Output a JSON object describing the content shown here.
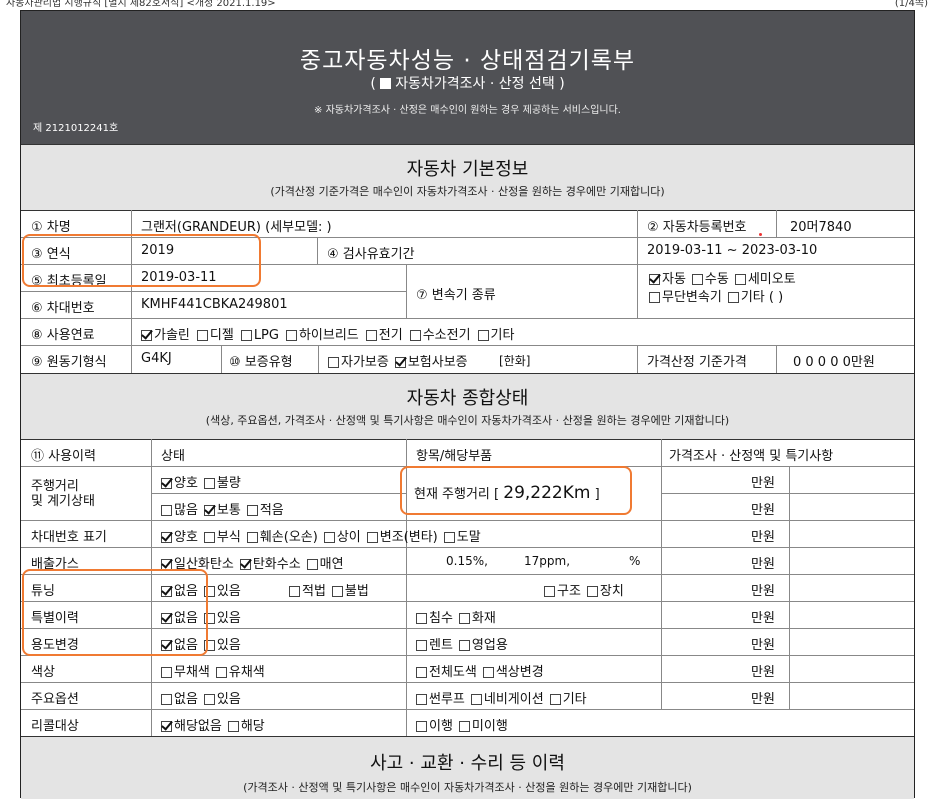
{
  "top": {
    "left": "자동차관리법 시행규칙 [별지 제82호서식] <개정 2021.1.19>",
    "right": "(1/4쪽)"
  },
  "header": {
    "title": "중고자동차성능 · 상태점검기록부",
    "sub_open": "(",
    "sub_text": "자동차가격조사 · 산정 선택",
    "sub_close": ")",
    "note": "※ 자동차가격조사 · 산정은 매수인이 원하는 경우 제공하는 서비스입니다.",
    "doc_no": "제 2121012241호"
  },
  "basic": {
    "title": "자동차 기본정보",
    "subtitle": "(가격산정 기준가격은 매수인이 자동차가격조사 · 산정을 원하는 경우에만 기재합니다)",
    "car_name_label": "① 차명",
    "car_name": "그랜저(GRANDEUR) (세부모델: )",
    "reg_no_label": "② 자동차등록번호",
    "reg_no": "20머7840",
    "year_label": "③ 연식",
    "year": "2019",
    "inspect_label": "④ 검사유효기간",
    "inspect_period": "2019-03-11 ~ 2023-03-10",
    "first_reg_label": "⑤ 최초등록일",
    "first_reg": "2019-03-11",
    "trans_label": "⑦ 변속기 종류",
    "trans_options_1": [
      {
        "label": "자동",
        "checked": true
      },
      {
        "label": "수동",
        "checked": false
      },
      {
        "label": "세미오토",
        "checked": false
      }
    ],
    "trans_options_2": [
      {
        "label": "무단변속기",
        "checked": false
      },
      {
        "label": "기타 (      )",
        "checked": false
      }
    ],
    "vin_label": "⑥ 차대번호",
    "vin": "KMHF441CBKA249801",
    "fuel_label": "⑧ 사용연료",
    "fuel_options": [
      {
        "label": "가솔린",
        "checked": true
      },
      {
        "label": "디젤",
        "checked": false
      },
      {
        "label": "LPG",
        "checked": false
      },
      {
        "label": "하이브리드",
        "checked": false
      },
      {
        "label": "전기",
        "checked": false
      },
      {
        "label": "수소전기",
        "checked": false
      },
      {
        "label": "기타",
        "checked": false
      }
    ],
    "engine_label": "⑨ 원동기형식",
    "engine": "G4KJ",
    "warranty_label": "⑩ 보증유형",
    "warranty_options": [
      {
        "label": "자가보증",
        "checked": false
      },
      {
        "label": "보험사보증",
        "checked": true
      }
    ],
    "warranty_company": "[한화]",
    "price_label": "가격산정 기준가격",
    "price_value": "0 0 0 0 0만원"
  },
  "overall": {
    "title": "자동차 종합상태",
    "subtitle": "(색상, 주요옵션, 가격조사 · 산정액 및 특기사항은 매수인이 자동차가격조사 · 산정을 원하는 경우에만 기재합니다)",
    "col_history": "⑪ 사용이력",
    "col_status": "상태",
    "col_item": "항목/해당부품",
    "col_price": "가격조사 · 산정액 및 특기사항",
    "unit": "만원",
    "mileage_label": "주행거리\n및 계기상태",
    "mileage_opts_1": [
      {
        "label": "양호",
        "checked": true
      },
      {
        "label": "불량",
        "checked": false
      }
    ],
    "mileage_opts_2": [
      {
        "label": "많음",
        "checked": false
      },
      {
        "label": "보통",
        "checked": true
      },
      {
        "label": "적음",
        "checked": false
      }
    ],
    "mileage_text_prefix": "현재 주행거리 [",
    "mileage_value": "29,222Km",
    "mileage_text_suffix": "]",
    "vin_mark_label": "차대번호 표기",
    "vin_mark_opts": [
      {
        "label": "양호",
        "checked": true
      },
      {
        "label": "부식",
        "checked": false
      },
      {
        "label": "훼손(오손)",
        "checked": false
      },
      {
        "label": "상이",
        "checked": false
      },
      {
        "label": "변조(변타)",
        "checked": false
      },
      {
        "label": "도말",
        "checked": false
      }
    ],
    "emission_label": "배출가스",
    "emission_opts": [
      {
        "label": "일산화탄소",
        "checked": true
      },
      {
        "label": "탄화수소",
        "checked": true
      },
      {
        "label": "매연",
        "checked": false
      }
    ],
    "emission_co": "0.15%,",
    "emission_hc": "17ppm,",
    "emission_pct": "%",
    "tuning_label": "튜닝",
    "tuning_opts": [
      {
        "label": "없음",
        "checked": true
      },
      {
        "label": "있음",
        "checked": false
      }
    ],
    "tuning_legal": [
      {
        "label": "적법",
        "checked": false
      },
      {
        "label": "불법",
        "checked": false
      }
    ],
    "tuning_parts": [
      {
        "label": "구조",
        "checked": false
      },
      {
        "label": "장치",
        "checked": false
      }
    ],
    "special_label": "특별이력",
    "special_opts": [
      {
        "label": "없음",
        "checked": true
      },
      {
        "label": "있음",
        "checked": false
      }
    ],
    "special_parts": [
      {
        "label": "침수",
        "checked": false
      },
      {
        "label": "화재",
        "checked": false
      }
    ],
    "usage_label": "용도변경",
    "usage_opts": [
      {
        "label": "없음",
        "checked": true
      },
      {
        "label": "있음",
        "checked": false
      }
    ],
    "usage_parts": [
      {
        "label": "렌트",
        "checked": false
      },
      {
        "label": "영업용",
        "checked": false
      }
    ],
    "color_label": "색상",
    "color_opts": [
      {
        "label": "무채색",
        "checked": false
      },
      {
        "label": "유채색",
        "checked": false
      }
    ],
    "color_parts": [
      {
        "label": "전체도색",
        "checked": false
      },
      {
        "label": "색상변경",
        "checked": false
      }
    ],
    "option_label": "주요옵션",
    "option_opts": [
      {
        "label": "없음",
        "checked": false
      },
      {
        "label": "있음",
        "checked": false
      }
    ],
    "option_parts": [
      {
        "label": "썬루프",
        "checked": false
      },
      {
        "label": "네비게이션",
        "checked": false
      },
      {
        "label": "기타",
        "checked": false
      }
    ],
    "recall_label": "리콜대상",
    "recall_opts": [
      {
        "label": "해당없음",
        "checked": true
      },
      {
        "label": "해당",
        "checked": false
      }
    ],
    "recall_parts": [
      {
        "label": "이행",
        "checked": false
      },
      {
        "label": "미이행",
        "checked": false
      }
    ]
  },
  "accident": {
    "title": "사고 · 교환 · 수리 등 이력",
    "subtitle": "(가격조사 · 산정액 및 특기사항은 매수인이 자동차가격조사 · 산정을 원하는 경우에만 기재합니다)"
  },
  "colors": {
    "header_bg": "#505155",
    "band_bg": "#e4e4e4",
    "highlight": "#f07a32"
  }
}
